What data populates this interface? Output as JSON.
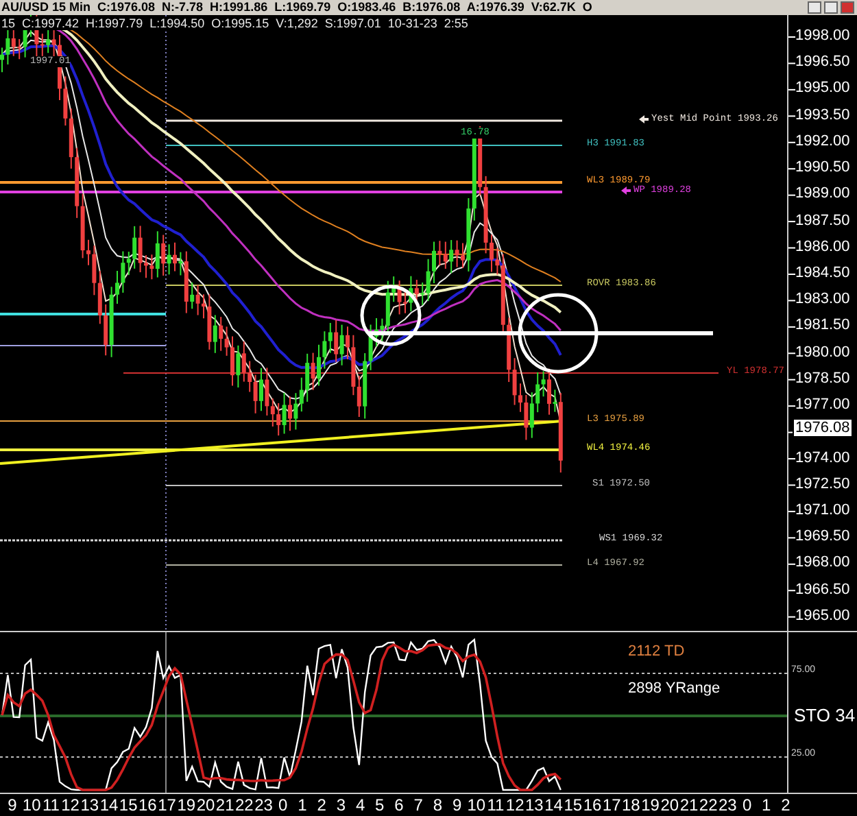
{
  "title_bar": {
    "text": "AU/USD 15 Min  C:1976.08  N:-7.78  H:1991.86  L:1969.79  O:1983.46  B:1976.08  A:1976.39  V:62.7K  O"
  },
  "bar_info": "15  C:1997.42  H:1997.79  L:1994.50  O:1995.15  V:1,292  S:1997.01  10-31-23  2:55",
  "price_axis": {
    "ticks": [
      "1998.00",
      "1996.50",
      "1995.00",
      "1993.50",
      "1992.00",
      "1990.50",
      "1989.00",
      "1987.50",
      "1986.00",
      "1984.50",
      "1983.00",
      "1981.50",
      "1980.00",
      "1978.50",
      "1977.00",
      "1974.00",
      "1972.50",
      "1971.00",
      "1969.50",
      "1968.00",
      "1966.50",
      "1965.00"
    ],
    "current_price": "1976.08"
  },
  "annotations": [
    {
      "text": "1997.01",
      "color": "#b8b8b8"
    },
    {
      "text": "16.78",
      "color": "#33cc66"
    }
  ],
  "levels": [
    {
      "label": "Yest Mid Point 1993.26",
      "color": "#f0e8e0",
      "kind": "arrow"
    },
    {
      "label": "H3 1991.83",
      "color": "#40c0c0",
      "kind": "plain"
    },
    {
      "label": "WL3 1989.79",
      "color": "#ff9a30",
      "kind": "plain"
    },
    {
      "label": "WP 1989.28",
      "color": "#e040e0",
      "kind": "arrow"
    },
    {
      "label": "ROVR 1983.86",
      "color": "#c8c860",
      "kind": "plain"
    },
    {
      "label": "YL 1978.77",
      "color": "#d03030",
      "kind": "plain"
    },
    {
      "label": "L3 1975.89",
      "color": "#e8a040",
      "kind": "plain"
    },
    {
      "label": "WL4 1974.46",
      "color": "#f0f040",
      "kind": "plain"
    },
    {
      "label": "S1 1972.50",
      "color": "#c0c0c0",
      "kind": "plain"
    },
    {
      "label": "WS1 1969.32",
      "color": "#d8d8d8",
      "kind": "plain"
    },
    {
      "label": "L4 1967.92",
      "color": "#b0b0a0",
      "kind": "plain"
    }
  ],
  "stochastic": {
    "labels": [
      {
        "text": "2112 TD",
        "color": "#e08040"
      },
      {
        "text": "2898 YRange",
        "color": "#ffffff"
      }
    ],
    "ticks": [
      "75.00",
      "25.00"
    ],
    "name": "STO 34"
  },
  "time_axis": [
    "9",
    "10",
    "11",
    "12",
    "13",
    "14",
    "15",
    "16",
    "17",
    "19",
    "20",
    "21",
    "22",
    "23",
    "0",
    "1",
    "2",
    "3",
    "4",
    "5",
    "6",
    "7",
    "8",
    "9",
    "10",
    "11",
    "12",
    "13",
    "14",
    "15",
    "16",
    "17",
    "18",
    "19",
    "20",
    "21",
    "22",
    "23",
    "0",
    "1",
    "2"
  ]
}
